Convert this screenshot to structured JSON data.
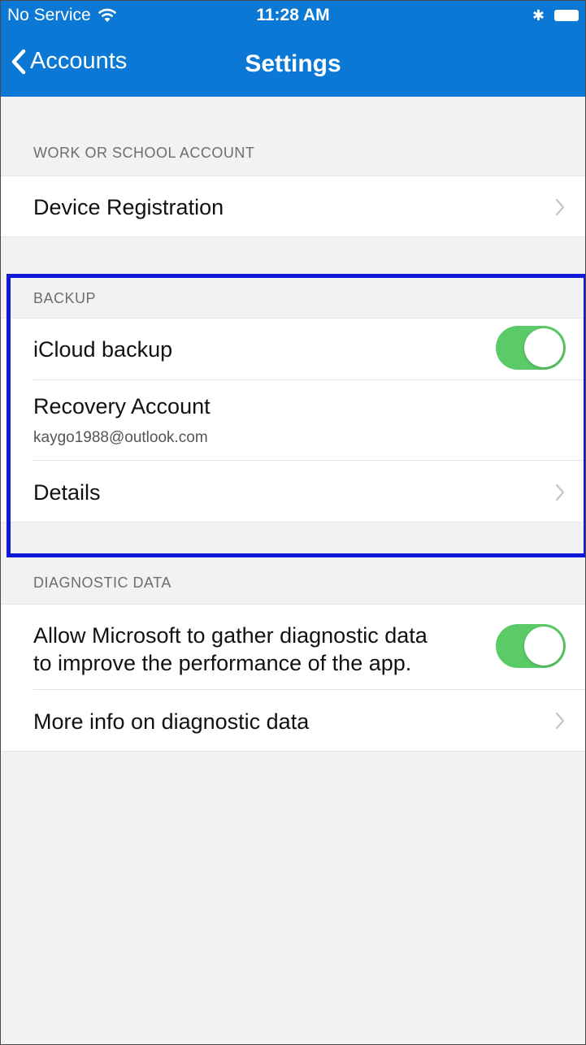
{
  "status_bar": {
    "carrier": "No Service",
    "time": "11:28 AM",
    "bluetooth_icon": "bluetooth-icon",
    "battery_icon": "battery-icon",
    "wifi_icon": "wifi-icon"
  },
  "nav": {
    "back_label": "Accounts",
    "title": "Settings",
    "bar_color": "#0a78d4"
  },
  "sections": {
    "work": {
      "header": "WORK OR SCHOOL ACCOUNT",
      "device_registration": "Device Registration"
    },
    "backup": {
      "header": "BACKUP",
      "icloud_label": "iCloud backup",
      "icloud_enabled": true,
      "recovery_label": "Recovery Account",
      "recovery_email": "kaygo1988@outlook.com",
      "details_label": "Details"
    },
    "diagnostic": {
      "header": "DIAGNOSTIC DATA",
      "allow_line1": "Allow Microsoft to gather diagnostic data",
      "allow_line2": "to improve the performance of the app.",
      "allow_enabled": true,
      "more_info_label": "More info on diagnostic data"
    }
  },
  "colors": {
    "toggle_on": "#5acb67",
    "highlight_border": "#1019d8"
  }
}
